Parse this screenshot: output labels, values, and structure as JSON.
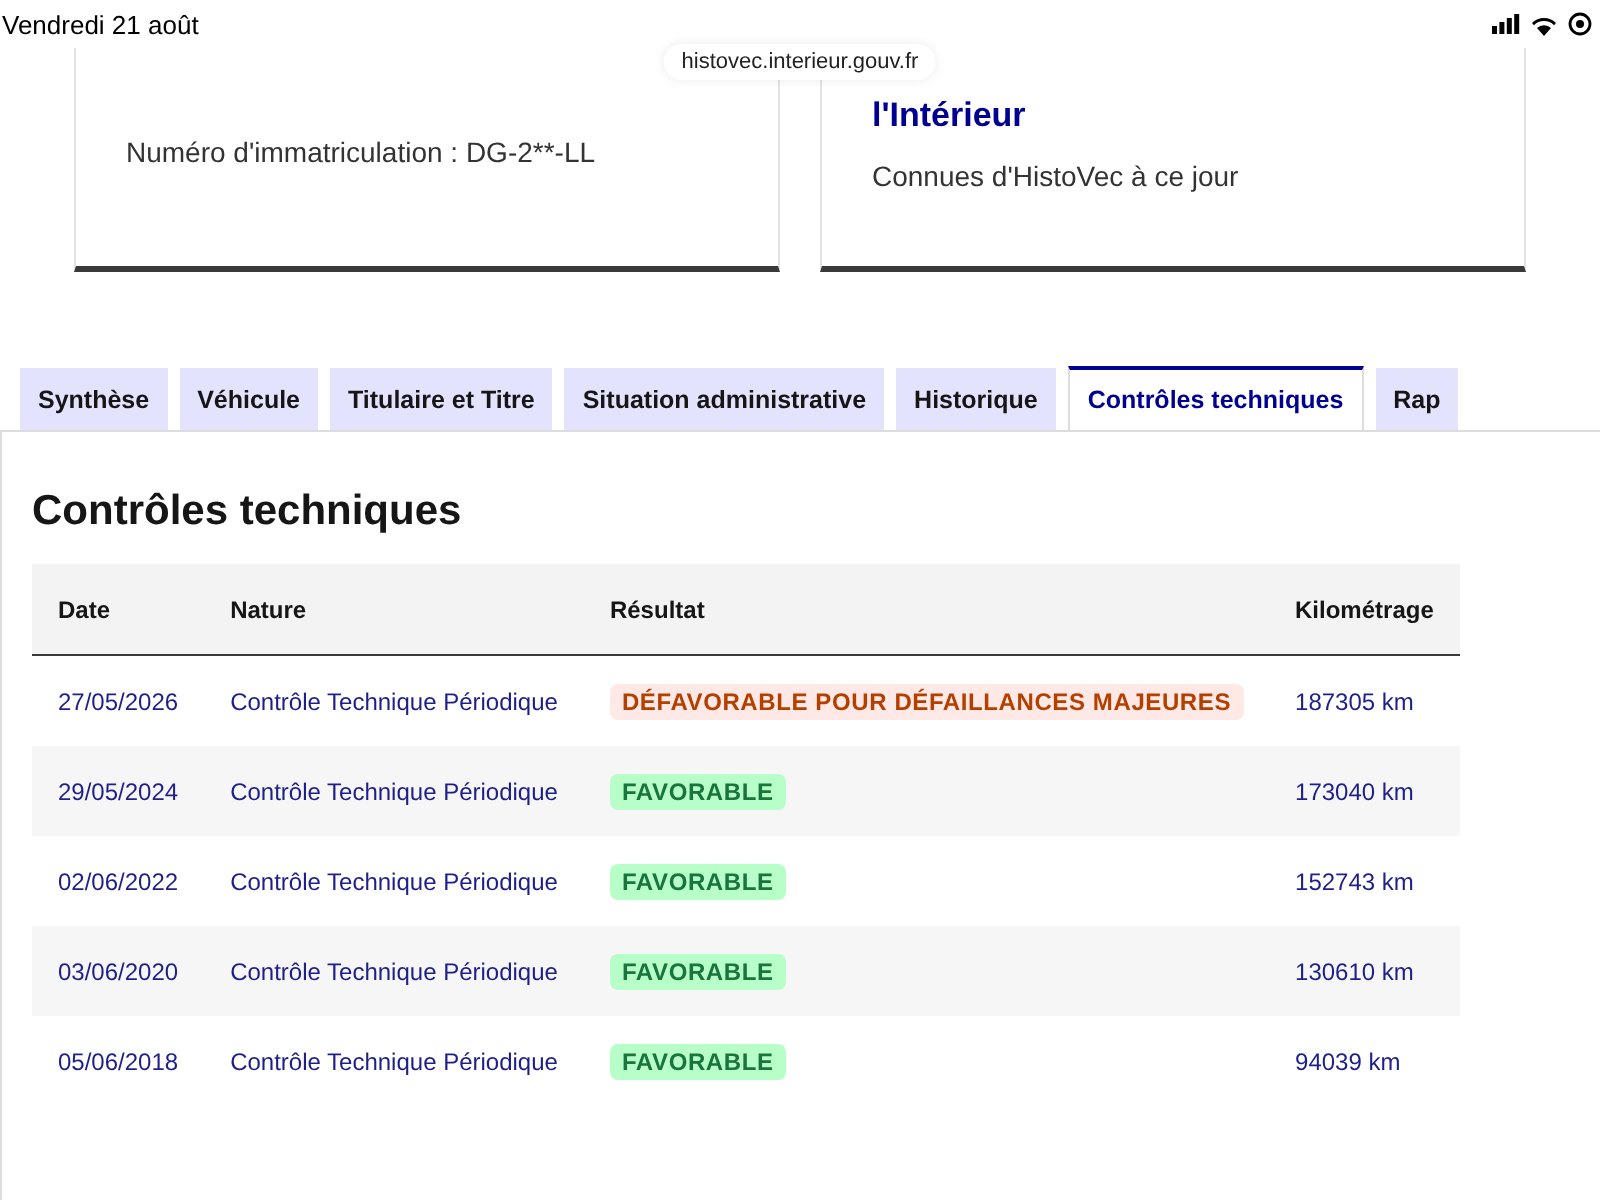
{
  "status_bar": {
    "date": "Vendredi 21 août"
  },
  "address_bar": {
    "url": "histovec.interieur.gouv.fr"
  },
  "cards": [
    {
      "text": "Numéro d'immatriculation : DG-2**-LL"
    },
    {
      "title": "l'Intérieur",
      "text": "Connues d'HistoVec à ce jour"
    }
  ],
  "tabs": [
    {
      "label": "Synthèse",
      "selected": false
    },
    {
      "label": "Véhicule",
      "selected": false
    },
    {
      "label": "Titulaire et Titre",
      "selected": false
    },
    {
      "label": "Situation administrative",
      "selected": false
    },
    {
      "label": "Historique",
      "selected": false
    },
    {
      "label": "Contrôles techniques",
      "selected": true
    },
    {
      "label": "Rap",
      "selected": false
    }
  ],
  "section": {
    "title": "Contrôles techniques"
  },
  "table": {
    "columns": [
      "Date",
      "Nature",
      "Résultat",
      "Kilométrage"
    ],
    "rows": [
      {
        "date": "27/05/2026",
        "nature": "Contrôle Technique Périodique",
        "result": {
          "label": "DÉFAVORABLE POUR DÉFAILLANCES MAJEURES",
          "kind": "error"
        },
        "mileage": "187305 km"
      },
      {
        "date": "29/05/2024",
        "nature": "Contrôle Technique Périodique",
        "result": {
          "label": "FAVORABLE",
          "kind": "success"
        },
        "mileage": "173040 km"
      },
      {
        "date": "02/06/2022",
        "nature": "Contrôle Technique Périodique",
        "result": {
          "label": "FAVORABLE",
          "kind": "success"
        },
        "mileage": "152743 km"
      },
      {
        "date": "03/06/2020",
        "nature": "Contrôle Technique Périodique",
        "result": {
          "label": "FAVORABLE",
          "kind": "success"
        },
        "mileage": "130610 km"
      },
      {
        "date": "05/06/2018",
        "nature": "Contrôle Technique Périodique",
        "result": {
          "label": "FAVORABLE",
          "kind": "success"
        },
        "mileage": "94039 km"
      }
    ]
  }
}
